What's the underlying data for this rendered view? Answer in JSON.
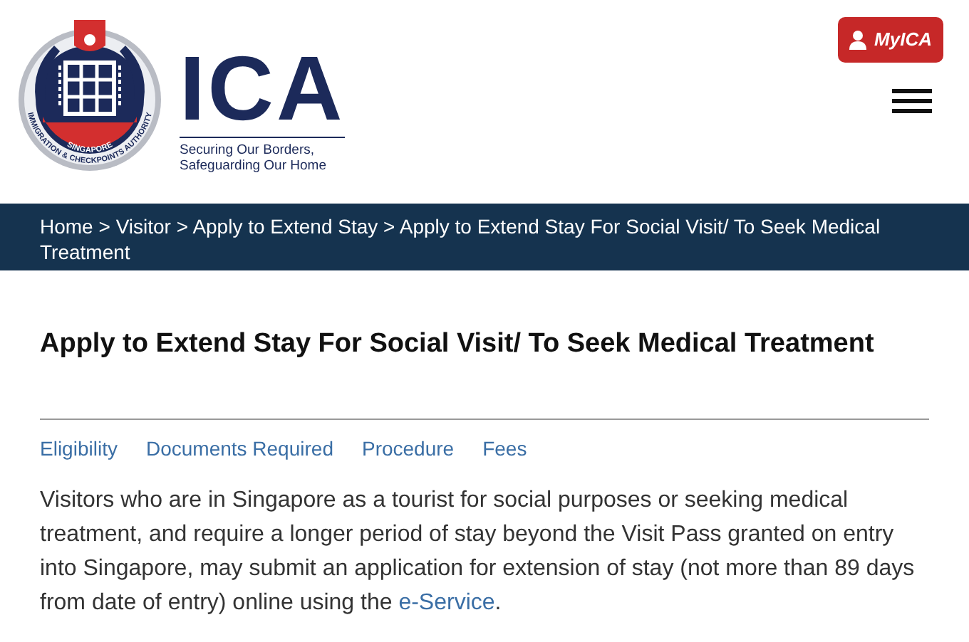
{
  "logo": {
    "seal_text": "IMMIGRATION & CHECKPOINTS AUTHORITY",
    "seal_subtext": "SINGAPORE",
    "wordmark": "ICA",
    "tagline_lines": [
      "Securing Our Borders,",
      "Safeguarding Our Home"
    ]
  },
  "account_button": {
    "label": "MyICA"
  },
  "breadcrumb": {
    "separator": ">",
    "items": [
      "Home",
      "Visitor",
      "Apply to Extend Stay",
      "Apply to Extend Stay For Social Visit/ To Seek Medical Treatment"
    ]
  },
  "title": "Apply to Extend Stay For Social Visit/ To Seek Medical Treatment",
  "section_links": [
    "Eligibility",
    "Documents Required",
    "Procedure",
    "Fees"
  ],
  "intro": {
    "text": "Visitors who are in Singapore as a tourist for social purposes or seeking medical treatment, and require a longer period of stay beyond the Visit Pass granted on entry into Singapore, may submit an application for extension of stay (not more than 89 days from date of entry) online using the ",
    "link": "e-Service",
    "after": "."
  }
}
